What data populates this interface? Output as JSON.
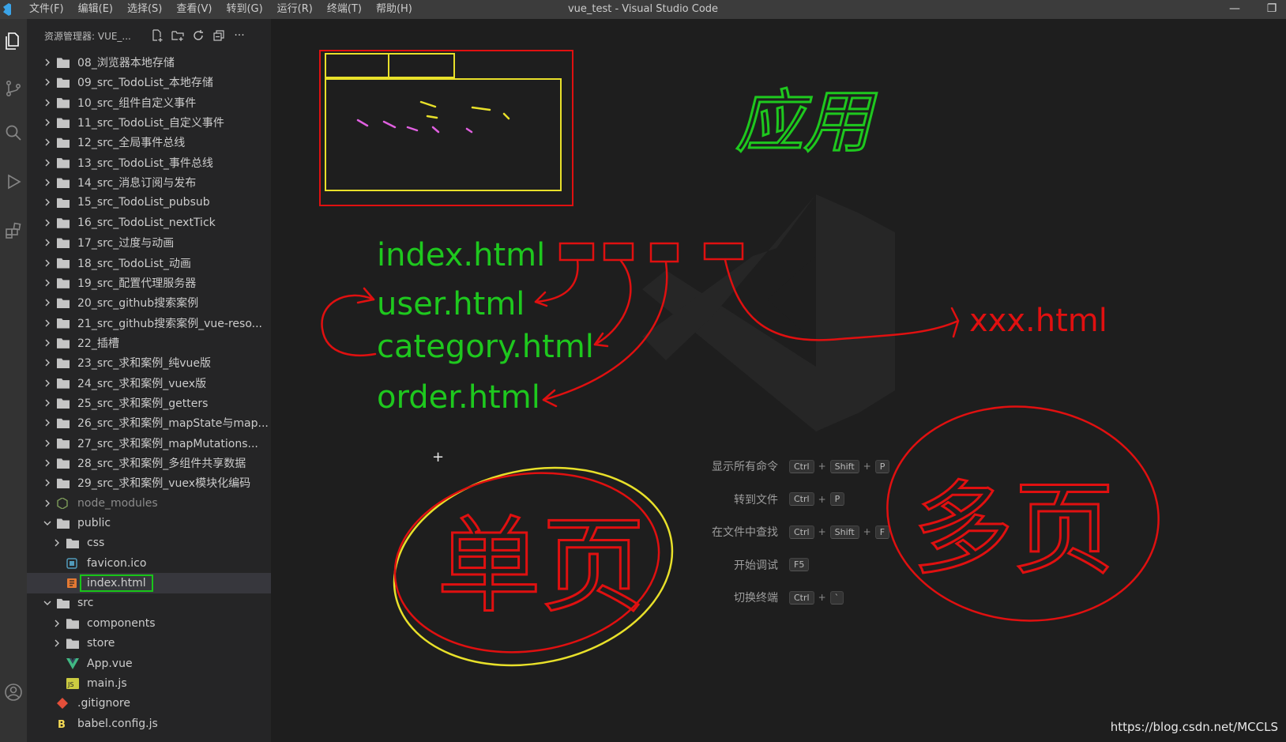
{
  "titlebar": {
    "window_title": "vue_test - Visual Studio Code",
    "menu": [
      "文件(F)",
      "编辑(E)",
      "选择(S)",
      "查看(V)",
      "转到(G)",
      "运行(R)",
      "终端(T)",
      "帮助(H)"
    ]
  },
  "activity_bar": {
    "icons": [
      "explorer-icon",
      "source-control-icon",
      "search-icon",
      "run-debug-icon",
      "extensions-icon",
      "account-icon"
    ]
  },
  "sidebar": {
    "title": "资源管理器: VUE_...",
    "tree": [
      {
        "label": "08_浏览器本地存储",
        "type": "folder",
        "depth": 0,
        "expanded": false
      },
      {
        "label": "09_src_TodoList_本地存储",
        "type": "folder",
        "depth": 0,
        "expanded": false
      },
      {
        "label": "10_src_组件自定义事件",
        "type": "folder",
        "depth": 0,
        "expanded": false
      },
      {
        "label": "11_src_TodoList_自定义事件",
        "type": "folder",
        "depth": 0,
        "expanded": false
      },
      {
        "label": "12_src_全局事件总线",
        "type": "folder",
        "depth": 0,
        "expanded": false
      },
      {
        "label": "13_src_TodoList_事件总线",
        "type": "folder",
        "depth": 0,
        "expanded": false
      },
      {
        "label": "14_src_消息订阅与发布",
        "type": "folder",
        "depth": 0,
        "expanded": false
      },
      {
        "label": "15_src_TodoList_pubsub",
        "type": "folder",
        "depth": 0,
        "expanded": false
      },
      {
        "label": "16_src_TodoList_nextTick",
        "type": "folder",
        "depth": 0,
        "expanded": false
      },
      {
        "label": "17_src_过度与动画",
        "type": "folder",
        "depth": 0,
        "expanded": false
      },
      {
        "label": "18_src_TodoList_动画",
        "type": "folder",
        "depth": 0,
        "expanded": false
      },
      {
        "label": "19_src_配置代理服务器",
        "type": "folder",
        "depth": 0,
        "expanded": false
      },
      {
        "label": "20_src_github搜索案例",
        "type": "folder",
        "depth": 0,
        "expanded": false
      },
      {
        "label": "21_src_github搜索案例_vue-reso...",
        "type": "folder",
        "depth": 0,
        "expanded": false
      },
      {
        "label": "22_插槽",
        "type": "folder",
        "depth": 0,
        "expanded": false
      },
      {
        "label": "23_src_求和案例_纯vue版",
        "type": "folder",
        "depth": 0,
        "expanded": false
      },
      {
        "label": "24_src_求和案例_vuex版",
        "type": "folder",
        "depth": 0,
        "expanded": false
      },
      {
        "label": "25_src_求和案例_getters",
        "type": "folder",
        "depth": 0,
        "expanded": false
      },
      {
        "label": "26_src_求和案例_mapState与map...",
        "type": "folder",
        "depth": 0,
        "expanded": false
      },
      {
        "label": "27_src_求和案例_mapMutations...",
        "type": "folder",
        "depth": 0,
        "expanded": false
      },
      {
        "label": "28_src_求和案例_多组件共享数据",
        "type": "folder",
        "depth": 0,
        "expanded": false
      },
      {
        "label": "29_src_求和案例_vuex模块化编码",
        "type": "folder",
        "depth": 0,
        "expanded": false
      },
      {
        "label": "node_modules",
        "type": "node",
        "depth": 0,
        "expanded": false
      },
      {
        "label": "public",
        "type": "folder",
        "depth": 0,
        "expanded": true
      },
      {
        "label": "css",
        "type": "folder",
        "depth": 1,
        "expanded": false
      },
      {
        "label": "favicon.ico",
        "type": "ico",
        "depth": 1
      },
      {
        "label": "index.html",
        "type": "html",
        "depth": 1,
        "selected": true
      },
      {
        "label": "src",
        "type": "folder",
        "depth": 0,
        "expanded": true
      },
      {
        "label": "components",
        "type": "folder",
        "depth": 1,
        "expanded": false
      },
      {
        "label": "store",
        "type": "folder",
        "depth": 1,
        "expanded": false
      },
      {
        "label": "App.vue",
        "type": "vue",
        "depth": 1
      },
      {
        "label": "main.js",
        "type": "js",
        "depth": 1
      },
      {
        "label": ".gitignore",
        "type": "git",
        "depth": 0
      },
      {
        "label": "babel.config.js",
        "type": "babel",
        "depth": 0
      }
    ]
  },
  "editor": {
    "shortcuts": [
      {
        "label": "显示所有命令",
        "keys": [
          "Ctrl",
          "Shift",
          "P"
        ]
      },
      {
        "label": "转到文件",
        "keys": [
          "Ctrl",
          "P"
        ]
      },
      {
        "label": "在文件中查找",
        "keys": [
          "Ctrl",
          "Shift",
          "F"
        ]
      },
      {
        "label": "开始调试",
        "keys": [
          "F5"
        ]
      },
      {
        "label": "切换终端",
        "keys": [
          "Ctrl",
          "`"
        ]
      }
    ],
    "annotations": {
      "app_label": "应用",
      "index_file": "index.html",
      "user_file": "user.html",
      "category_file": "category.html",
      "order_file": "order.html",
      "xxx_file": "xxx.html",
      "single_page_label": "单页",
      "multi_page_label": "多页"
    },
    "colors": {
      "green_ink": "#1ec81e",
      "red_ink": "#e01010",
      "yellow_ink": "#e8e02a"
    }
  },
  "footer": {
    "url": "https://blog.csdn.net/MCCLS"
  }
}
